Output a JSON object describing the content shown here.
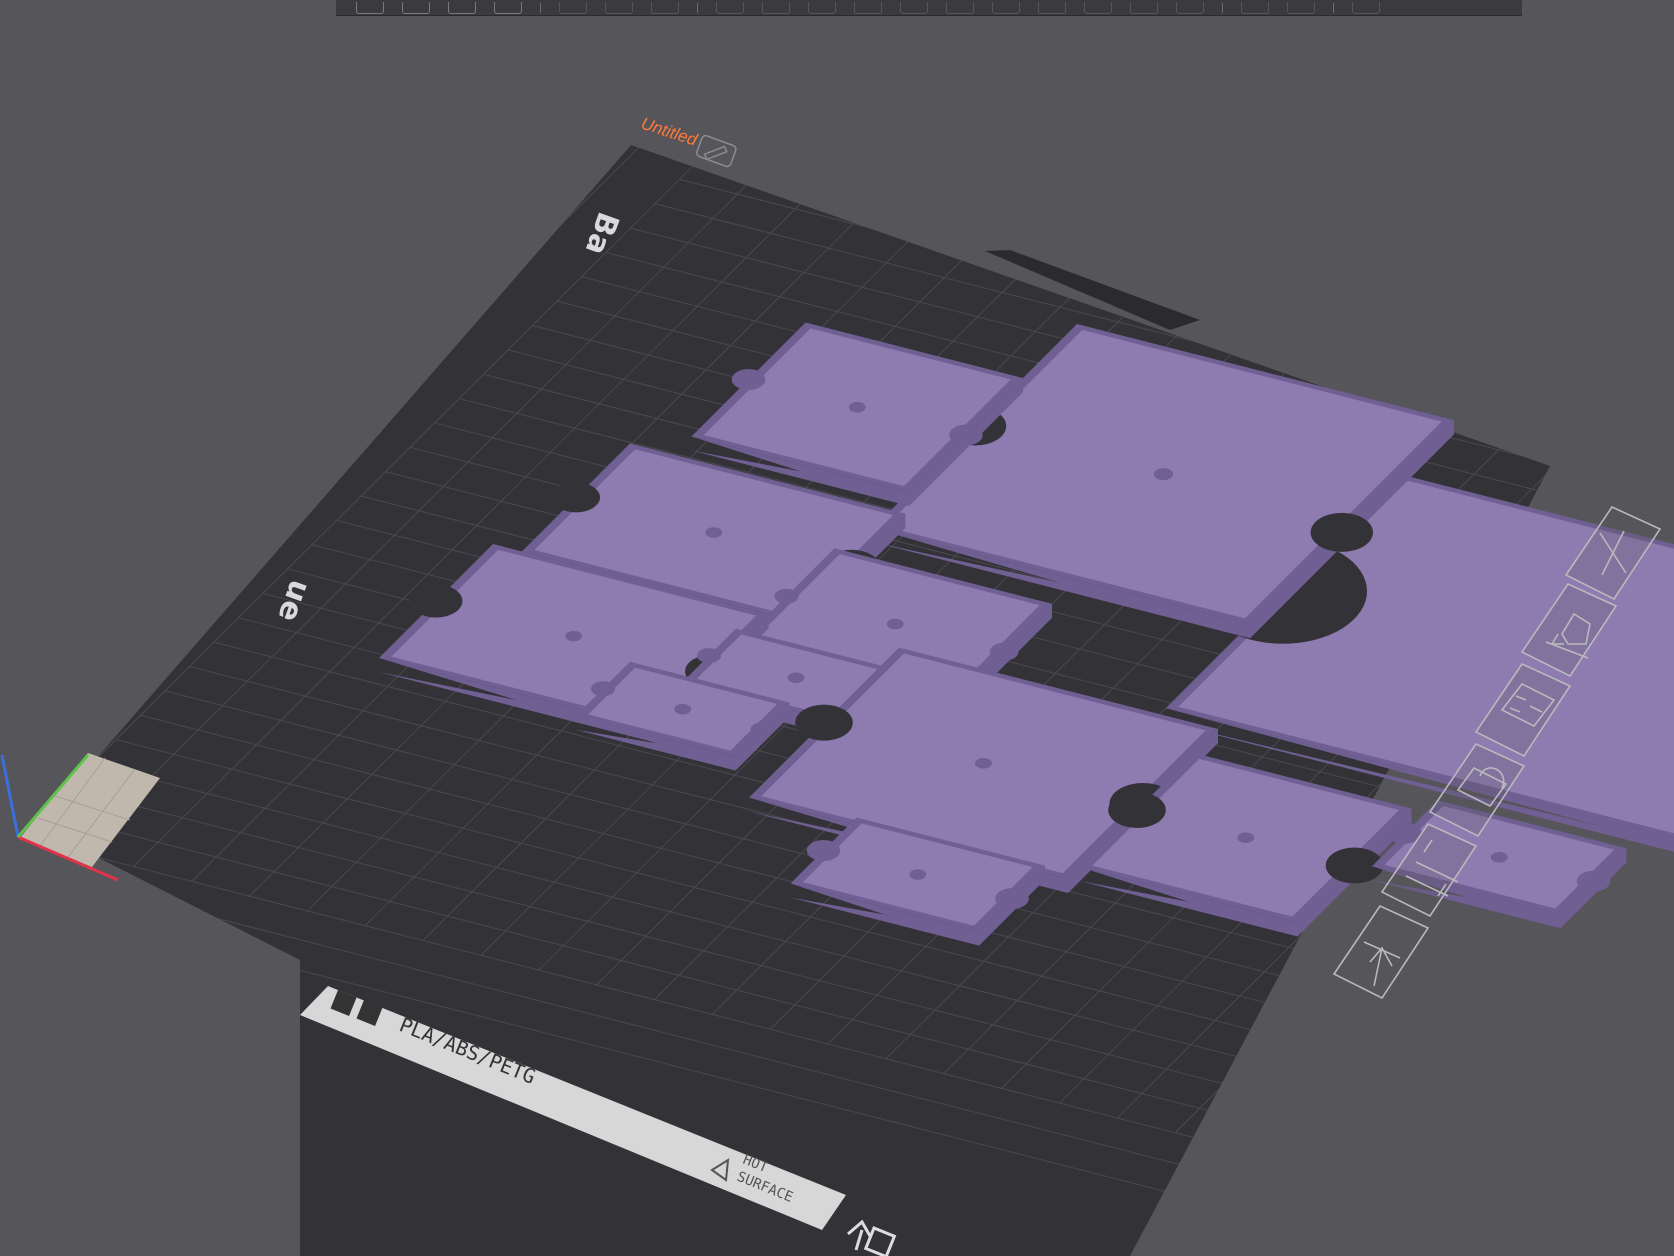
{
  "app": {
    "project_name": "Untitled"
  },
  "toolbar": {
    "buttons": [
      "add-icon",
      "grid-add-icon",
      "auto-arrange-icon",
      "plate-icon",
      "split-icon",
      "orient-icon",
      "layers-icon",
      "undo-icon",
      "redo-icon",
      "cut-icon",
      "scale-icon",
      "rotate-icon",
      "move-icon",
      "measure-icon",
      "support-paint-icon",
      "seam-paint-icon",
      "color-paint-icon",
      "text-icon",
      "variable-layer-icon",
      "assembly-icon",
      "view-icon"
    ]
  },
  "plate": {
    "label_text": "PLA/ABS/PETG",
    "warning_text_1": "HOT",
    "warning_text_2": "SURFACE",
    "brand_fragment_1": "Ba",
    "brand_fragment_2": "ue"
  },
  "plate_controls": [
    {
      "name": "close-plate-button",
      "icon": "close-icon"
    },
    {
      "name": "auto-orient-plate-button",
      "icon": "auto-orient-icon"
    },
    {
      "name": "arrange-plate-button",
      "icon": "arrange-icon"
    },
    {
      "name": "lock-plate-button",
      "icon": "lock-icon"
    },
    {
      "name": "plate-settings-button",
      "icon": "sliders-icon"
    },
    {
      "name": "move-plate-to-top-button",
      "icon": "move-to-top-icon"
    }
  ],
  "colors": {
    "background": "#56555a",
    "bed": "#333237",
    "grid": "#4a4950",
    "model_top": "#8e7bb0",
    "model_side": "#6f5f92",
    "accent": "#ff7a3d"
  }
}
